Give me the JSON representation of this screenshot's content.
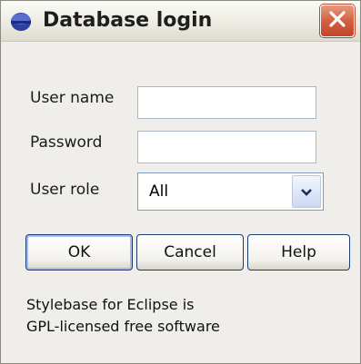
{
  "window": {
    "title": "Database login",
    "icon": "database-icon",
    "close_icon": "close-icon"
  },
  "form": {
    "username_label": "User name",
    "username_value": "",
    "password_label": "Password",
    "password_value": "",
    "role_label": "User role",
    "role_selected": "All"
  },
  "buttons": {
    "ok": "OK",
    "cancel": "Cancel",
    "help": "Help"
  },
  "note": {
    "line1": "Stylebase for Eclipse is",
    "line2": "GPL-licensed free software"
  },
  "colors": {
    "close_button": "#c9543a",
    "dialog_background": "#efeeea",
    "button_border": "#1b3c6e"
  }
}
